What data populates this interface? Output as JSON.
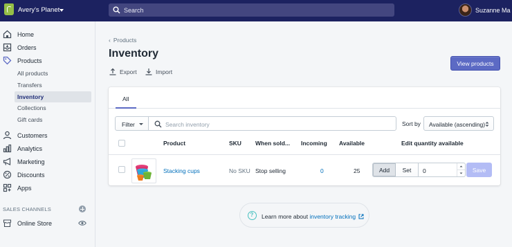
{
  "topbar": {
    "store_name": "Avery's Planet",
    "search_placeholder": "Search",
    "user_name": "Suzanne Ma"
  },
  "sidebar": {
    "items": [
      {
        "label": "Home",
        "icon": "home-icon"
      },
      {
        "label": "Orders",
        "icon": "orders-icon"
      },
      {
        "label": "Products",
        "icon": "tag-icon"
      }
    ],
    "product_subitems": [
      "All products",
      "Transfers",
      "Inventory",
      "Collections",
      "Gift cards"
    ],
    "active_subitem": "Inventory",
    "more_items": [
      {
        "label": "Customers",
        "icon": "customers-icon"
      },
      {
        "label": "Analytics",
        "icon": "analytics-icon"
      },
      {
        "label": "Marketing",
        "icon": "marketing-icon"
      },
      {
        "label": "Discounts",
        "icon": "discounts-icon"
      },
      {
        "label": "Apps",
        "icon": "apps-icon"
      }
    ],
    "sales_channels_title": "SALES CHANNELS",
    "online_store": "Online Store"
  },
  "page": {
    "breadcrumb": "Products",
    "title": "Inventory",
    "export_label": "Export",
    "import_label": "Import",
    "view_products_label": "View products"
  },
  "card": {
    "tab_all": "All",
    "filter_label": "Filter",
    "search_placeholder": "Search inventory",
    "sort_label": "Sort by",
    "sort_value": "Available (ascending)",
    "columns": {
      "product": "Product",
      "sku": "SKU",
      "when_sold": "When sold...",
      "incoming": "Incoming",
      "available": "Available",
      "edit_qty": "Edit quantity available"
    },
    "row": {
      "product": "Stacking cups",
      "sku": "No SKU",
      "when_sold": "Stop selling",
      "incoming": "0",
      "available": "25",
      "add_label": "Add",
      "set_label": "Set",
      "qty_value": "0",
      "save_label": "Save"
    }
  },
  "help": {
    "text": "Learn more about ",
    "link": "inventory tracking"
  },
  "colors": {
    "topbar": "#1c2260",
    "primary": "#5c6ac4",
    "link": "#006fbb",
    "save_disabled": "#b3bcf5"
  }
}
